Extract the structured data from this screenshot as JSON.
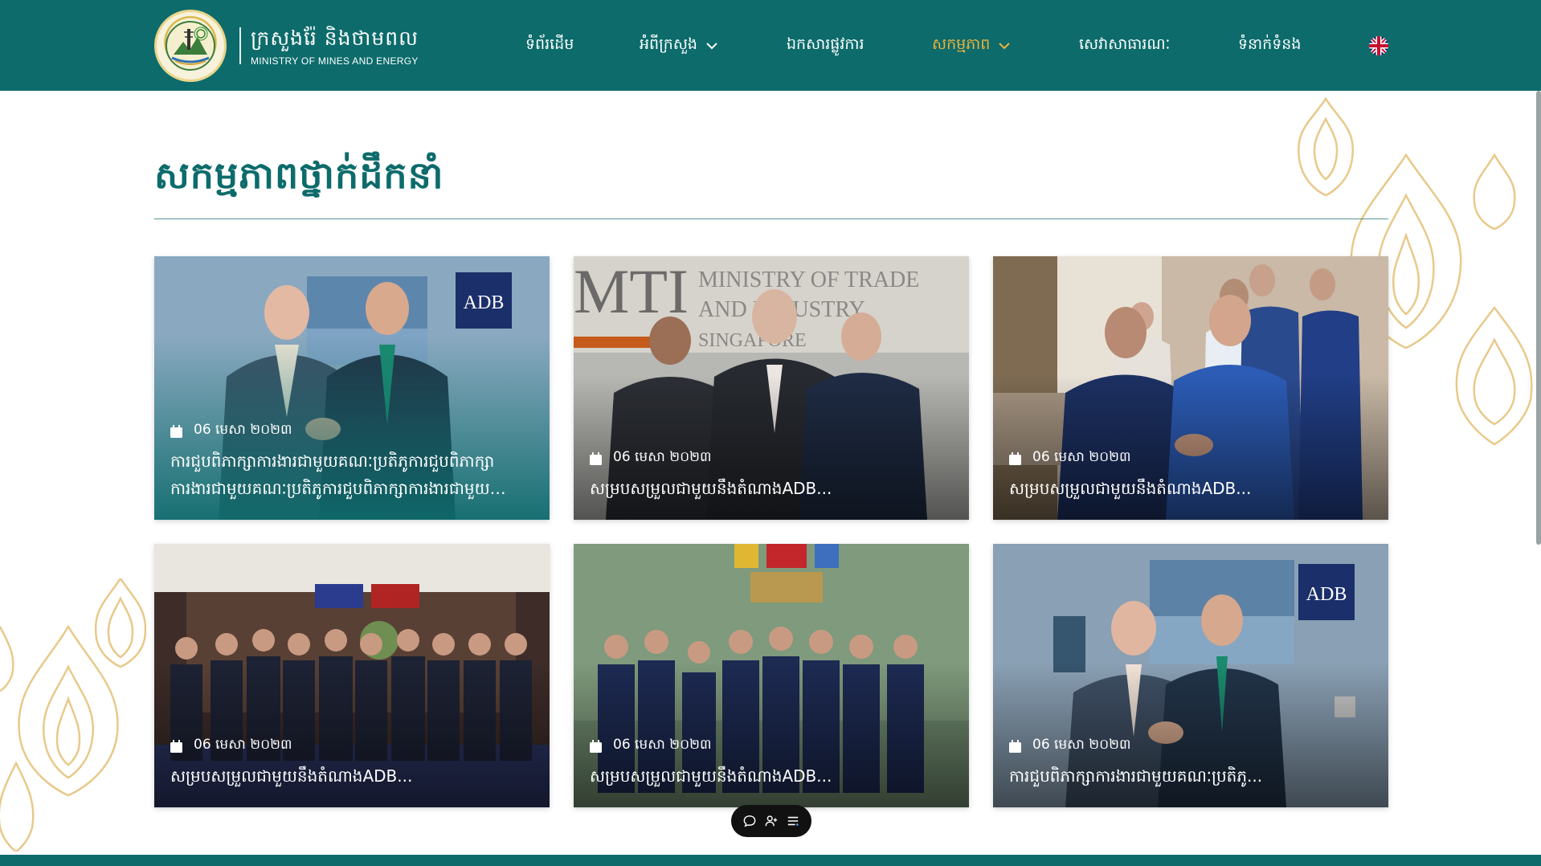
{
  "header": {
    "logo_kh": "ក្រសួងរ៉ែ និងថាមពល",
    "logo_en": "MINISTRY OF MINES AND ENERGY",
    "nav": [
      {
        "label": "ទំព័រដើម",
        "dropdown": false,
        "active": false
      },
      {
        "label": "អំពីក្រសួង",
        "dropdown": true,
        "active": false
      },
      {
        "label": "ឯកសារផ្លូវការ",
        "dropdown": false,
        "active": false
      },
      {
        "label": "សកម្មភាព",
        "dropdown": true,
        "active": true
      },
      {
        "label": "សេវាសាធារណៈ",
        "dropdown": false,
        "active": false
      },
      {
        "label": "ទំនាក់ទំនង",
        "dropdown": false,
        "active": false
      }
    ],
    "language_icon": "uk-flag-icon"
  },
  "page": {
    "title": "សកម្មភាពថ្នាក់ដឹកនាំ"
  },
  "cards": [
    {
      "date": "06 មេសា ២០២៣",
      "title": "ការជួបពិភាក្សាការងារជាមួយគណៈប្រតិភូការជួបពិភាក្សាការងារជាមួយគណៈប្រតិភូការជួបពិភាក្សាការងារជាមួយគណៈប្រតិភូ",
      "style": "featured"
    },
    {
      "date": "06 មេសា ២០២៣",
      "title": "សម្របសម្រួលជាមួយនឹងតំណាងADB...",
      "style": "normal"
    },
    {
      "date": "06 មេសា ២០២៣",
      "title": "សម្របសម្រួលជាមួយនឹងតំណាងADB...",
      "style": "normal"
    },
    {
      "date": "06 មេសា ២០២៣",
      "title": "សម្របសម្រួលជាមួយនឹងតំណាងADB...",
      "style": "normal"
    },
    {
      "date": "06 មេសា ២០២៣",
      "title": "សម្របសម្រួលជាមួយនឹងតំណាងADB...",
      "style": "normal"
    },
    {
      "date": "06 មេសា ២០២៣",
      "title": "ការជួបពិភាក្សាការងារជាមួយគណៈប្រតិភូ...",
      "style": "normal"
    }
  ],
  "float_toolbar": [
    "chat-icon",
    "user-add-icon",
    "menu-list-icon"
  ],
  "colors": {
    "primary": "#0d6b6b",
    "accent": "#f0b23b",
    "ornament": "#e8c98a"
  }
}
